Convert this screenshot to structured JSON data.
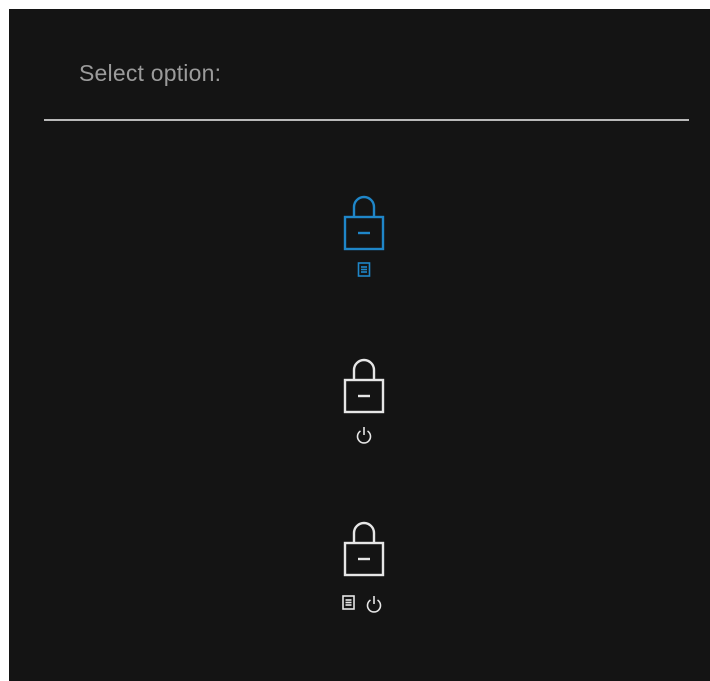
{
  "dialog": {
    "title": "Select option:"
  },
  "options": [
    {
      "name": "lock-menu",
      "icons": [
        "lock-icon",
        "menu-button-icon"
      ],
      "selected": true
    },
    {
      "name": "lock-power",
      "icons": [
        "lock-icon",
        "power-icon"
      ],
      "selected": false
    },
    {
      "name": "lock-menu-power",
      "icons": [
        "lock-icon",
        "menu-button-icon",
        "power-icon"
      ],
      "selected": false
    }
  ],
  "colors": {
    "background": "#141414",
    "title_text": "#9b9b9b",
    "divider": "#b9b9b9",
    "selected_accent": "#1f86c8",
    "icon_default": "#e6e6e6"
  }
}
